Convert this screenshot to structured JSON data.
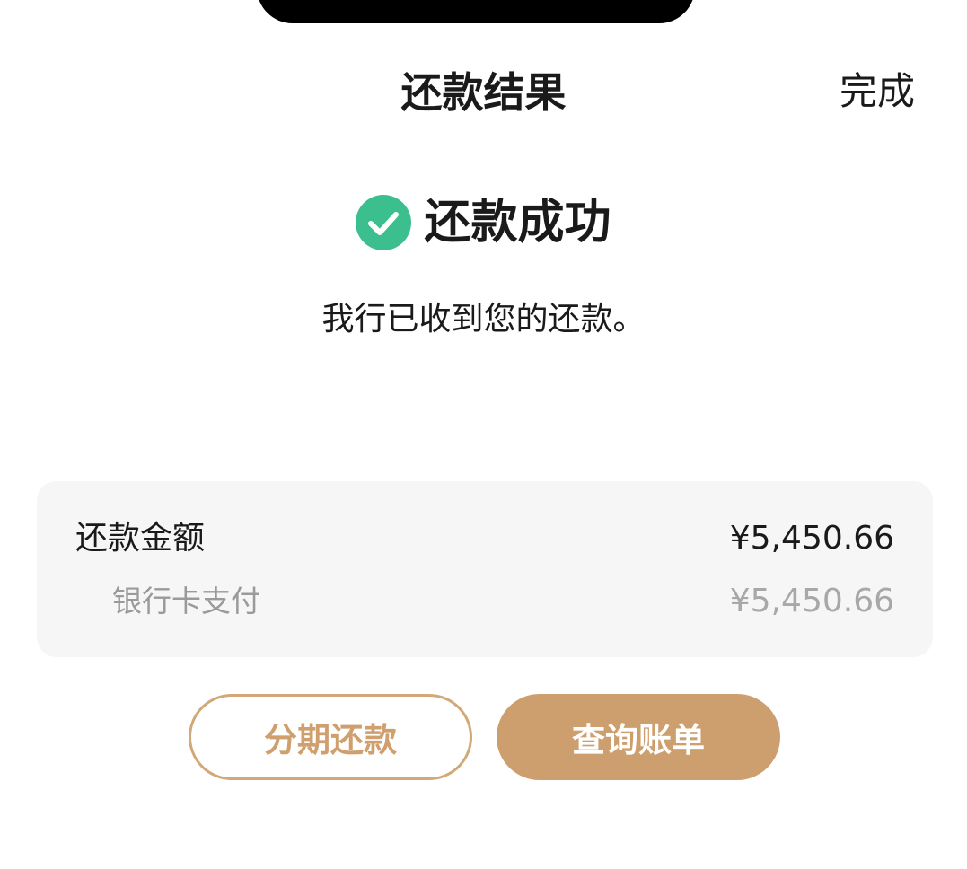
{
  "nav": {
    "title": "还款结果",
    "done_label": "完成"
  },
  "status": {
    "icon": "check-circle-icon",
    "icon_color": "#3cbf8e",
    "title": "还款成功",
    "description": "我行已收到您的还款。"
  },
  "summary": {
    "amount_label": "还款金额",
    "amount_value": "¥5,450.66",
    "method_label": "银行卡支付",
    "method_value": "¥5,450.66"
  },
  "actions": {
    "installment_label": "分期还款",
    "view_bill_label": "查询账单",
    "accent_color": "#ce9f6e"
  }
}
